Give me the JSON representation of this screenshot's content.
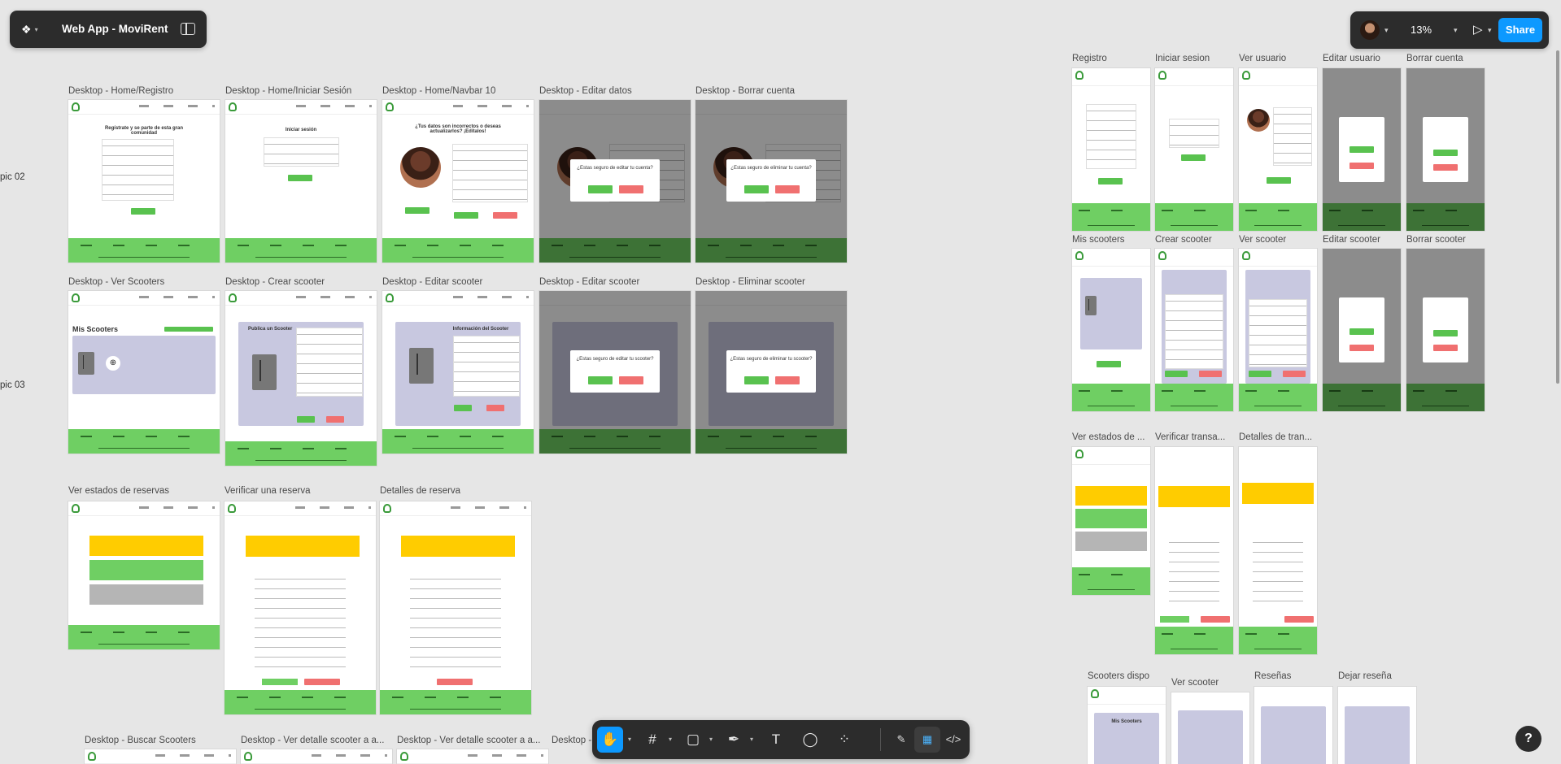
{
  "app": {
    "file_name": "Web App - MoviRent",
    "zoom": "13%",
    "share_label": "Share",
    "help_label": "?"
  },
  "side_labels": [
    "pic 02",
    "pic 03"
  ],
  "desktop_frames": {
    "row1": [
      "Desktop - Home/Registro",
      "Desktop - Home/Iniciar Sesión",
      "Desktop - Home/Navbar 10",
      "Desktop - Editar datos",
      "Desktop - Borrar cuenta"
    ],
    "row2": [
      "Desktop - Ver Scooters",
      "Desktop - Crear scooter",
      "Desktop - Editar scooter",
      "Desktop - Editar scooter",
      "Desktop - Eliminar scooter"
    ],
    "row3": [
      "Ver estados de reservas",
      "Verificar una reserva",
      "Detalles de reserva"
    ],
    "row4": [
      "Desktop - Buscar Scooters",
      "Desktop - Ver detalle scooter a a...",
      "Desktop - Ver detalle scooter a a...",
      "Desktop -"
    ]
  },
  "mobile_frames": {
    "row1": [
      "Registro",
      "Iniciar sesion",
      "Ver usuario",
      "Editar usuario",
      "Borrar cuenta"
    ],
    "row2": [
      "Mis scooters",
      "Crear scooter",
      "Ver scooter",
      "Editar scooter",
      "Borrar scooter"
    ],
    "row3": [
      "Ver estados de ...",
      "Verificar transa...",
      "Detalles de tran..."
    ],
    "row4": [
      "Scooters dispo",
      "Ver scooter",
      "Reseñas",
      "Dejar reseña"
    ]
  },
  "frame_texts": {
    "registro_title": "Regístrate y se parte de esta gran comunidad",
    "iniciar_title": "Iniciar sesión",
    "navbar_title": "¿Tus datos son incorrectos o deseas actualizarlos? ¡Edítalos!",
    "editar_modal": "¿Estas seguro de editar tu cuenta?",
    "borrar_modal": "¿Estas seguro de eliminar tu cuenta?",
    "mis_scooters": "Mis Scooters",
    "publica": "Publica un Scooter",
    "info_scooter": "Información del Scooter",
    "editar_scooter_modal": "¿Estas seguro de editar tu scooter?",
    "eliminar_scooter_modal": "¿Estas seguro de eliminar tu scooter?"
  },
  "toolbar": {
    "tools": [
      "hand-tool",
      "frame-tool",
      "shape-tool",
      "pen-tool",
      "text-tool",
      "comment-tool",
      "components-tool"
    ],
    "modes": [
      "draw-mode",
      "design-mode",
      "dev-mode"
    ]
  },
  "colors": {
    "green": "#6fcf63",
    "yellow": "#ffcc00",
    "red": "#f07070",
    "purple": "#c8c8e0",
    "accent": "#0d99ff",
    "toolbar_bg": "#2c2c2c"
  }
}
